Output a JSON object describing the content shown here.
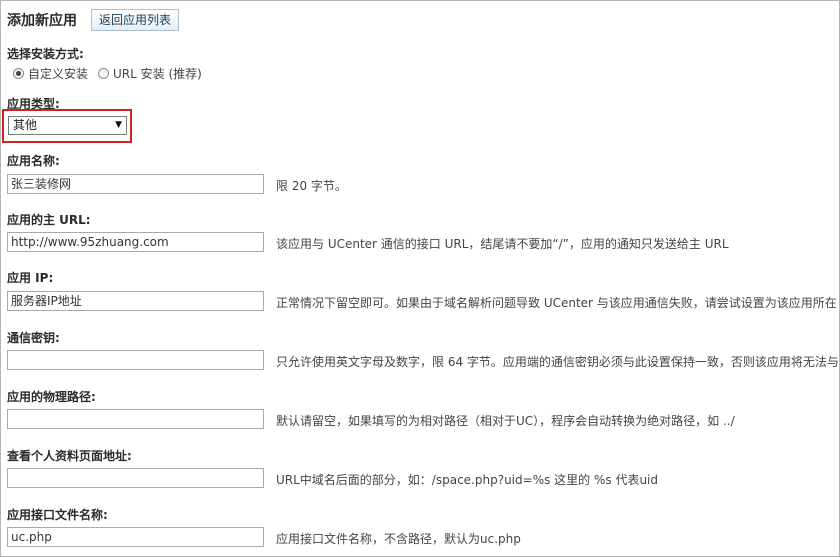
{
  "header": {
    "title": "添加新应用",
    "back_button": "返回应用列表"
  },
  "install_method": {
    "label": "选择安装方式:",
    "options": [
      {
        "label": "自定义安装",
        "checked": true
      },
      {
        "label": "URL 安装 (推荐)",
        "checked": false
      }
    ]
  },
  "app_type": {
    "label": "应用类型:",
    "selected": "其他"
  },
  "fields": [
    {
      "label": "应用名称:",
      "value": "张三装修网",
      "hint": "限 20 字节。"
    },
    {
      "label": "应用的主 URL:",
      "value": "http://www.95zhuang.com",
      "hint": "该应用与 UCenter 通信的接口 URL，结尾请不要加“/”，应用的通知只发送给主 URL"
    },
    {
      "label": "应用 IP:",
      "value": "服务器IP地址",
      "hint": "正常情况下留空即可。如果由于域名解析问题导致 UCenter 与该应用通信失败，请尝试设置为该应用所在"
    },
    {
      "label": "通信密钥:",
      "value": "",
      "hint": "只允许使用英文字母及数字，限 64 字节。应用端的通信密钥必须与此设置保持一致，否则该应用将无法与"
    },
    {
      "label": "应用的物理路径:",
      "value": "",
      "hint": "默认请留空，如果填写的为相对路径（相对于UC），程序会自动转换为绝对路径，如 ../"
    },
    {
      "label": "查看个人资料页面地址:",
      "value": "",
      "hint": "URL中域名后面的部分，如：/space.php?uid=%s 这里的 %s 代表uid"
    },
    {
      "label": "应用接口文件名称:",
      "value": "uc.php",
      "hint": "应用接口文件名称，不含路径，默认为uc.php"
    }
  ]
}
